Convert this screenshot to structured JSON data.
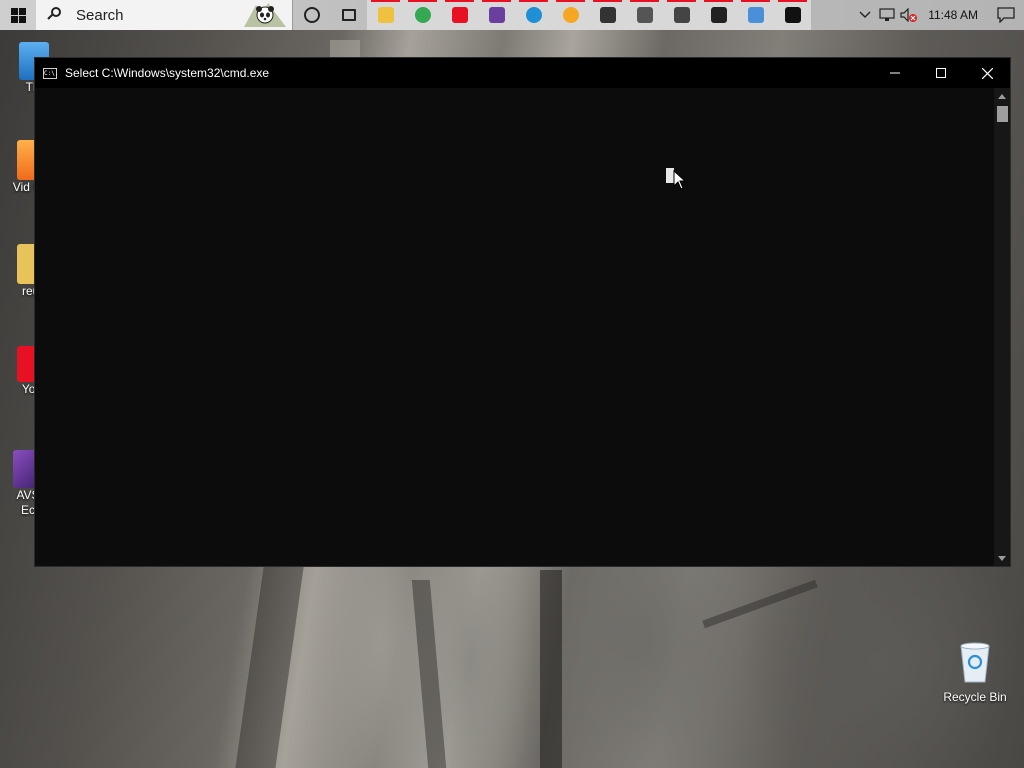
{
  "taskbar": {
    "search_placeholder": "Search",
    "clock": "11:48 AM",
    "pinned_apps": [
      {
        "name": "cortana-icon",
        "color": "#222222",
        "running": false
      },
      {
        "name": "task-view-icon",
        "color": "#222222",
        "running": false
      },
      {
        "name": "file-explorer-icon",
        "color": "#f0c040",
        "running": true
      },
      {
        "name": "chrome-icon",
        "color": "#34a853",
        "running": true
      },
      {
        "name": "youtube-icon",
        "color": "#e81123",
        "running": true
      },
      {
        "name": "video-editor-icon",
        "color": "#6a3fa0",
        "running": true
      },
      {
        "name": "edge-icon",
        "color": "#1f8fd6",
        "running": true
      },
      {
        "name": "media-player-icon",
        "color": "#f5a623",
        "running": true
      },
      {
        "name": "clapperboard-icon",
        "color": "#333333",
        "running": true
      },
      {
        "name": "calculator-icon",
        "color": "#555555",
        "running": true
      },
      {
        "name": "alarms-icon",
        "color": "#444444",
        "running": true
      },
      {
        "name": "store-icon",
        "color": "#222222",
        "running": true
      },
      {
        "name": "settings-app-icon",
        "color": "#4a90d9",
        "running": true
      },
      {
        "name": "cmd-taskbar-icon",
        "color": "#111111",
        "running": true
      }
    ]
  },
  "desktop": {
    "icons": [
      {
        "label": "Thi"
      },
      {
        "label": "Vid Uni"
      },
      {
        "label": "reuj"
      },
      {
        "label": "You"
      },
      {
        "label": "AVS Ec"
      }
    ],
    "recycle_bin_label": "Recycle Bin"
  },
  "window": {
    "title": "Select C:\\Windows\\system32\\cmd.exe",
    "icon_text": "C:\\."
  },
  "colors": {
    "console_bg": "#0c0c0c",
    "titlebar_bg": "#000000",
    "accent_red": "#e81123"
  }
}
